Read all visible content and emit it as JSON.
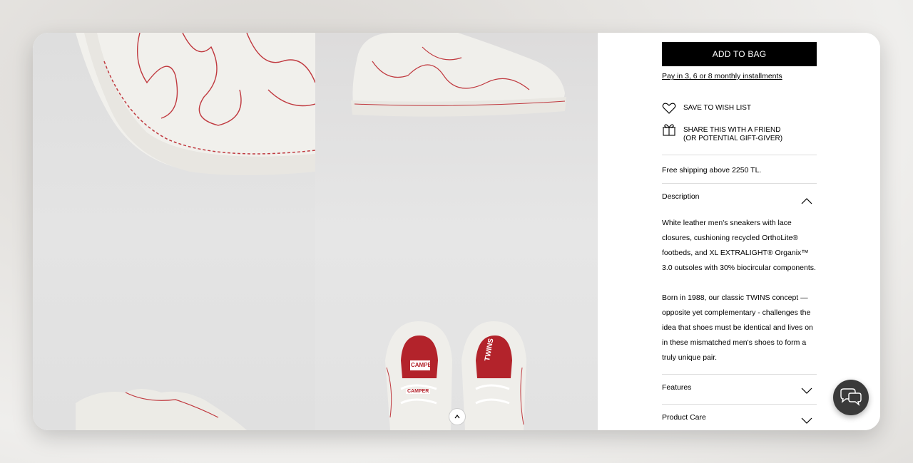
{
  "product": {
    "add_to_bag": "ADD TO BAG",
    "pay_installments": "Pay in 3, 6 or 8 monthly installments",
    "wish_list": "SAVE TO WISH LIST",
    "share_line1": "SHARE THIS WITH A FRIEND",
    "share_line2": "(OR POTENTIAL GIFT-GIVER)",
    "shipping": "Free shipping above 2250 TL."
  },
  "accordion": {
    "description": {
      "title": "Description",
      "state": "expanded",
      "para1": "White leather men's sneakers with lace closures, cushioning recycled OrthoLite® footbeds, and XL EXTRALIGHT® Organix™ 3.0 outsoles with 30% biocircular components.",
      "para2": "Born in 1988, our classic TWINS concept — opposite yet complementary - challenges the idea that shoes must be identical and lives on in these mismatched men's shoes to form a truly unique pair."
    },
    "features": {
      "title": "Features",
      "state": "collapsed"
    },
    "care": {
      "title": "Product Care",
      "state": "collapsed"
    }
  },
  "gallery": {
    "insole_left_brand": "CAMPER",
    "insole_right_brand": "TWINS",
    "heel_tab_brand": "CAMPER"
  },
  "icons": {
    "heart": "heart-icon",
    "gift": "gift-icon",
    "chevron_up": "chevron-up-icon",
    "chevron_down": "chevron-down-icon",
    "chat": "chat-bubbles-icon",
    "scroll_up": "arrow-up-icon"
  },
  "colors": {
    "button_bg": "#000000",
    "stitch_red": "#c0393f",
    "chat_bg": "#3a3a3a"
  }
}
